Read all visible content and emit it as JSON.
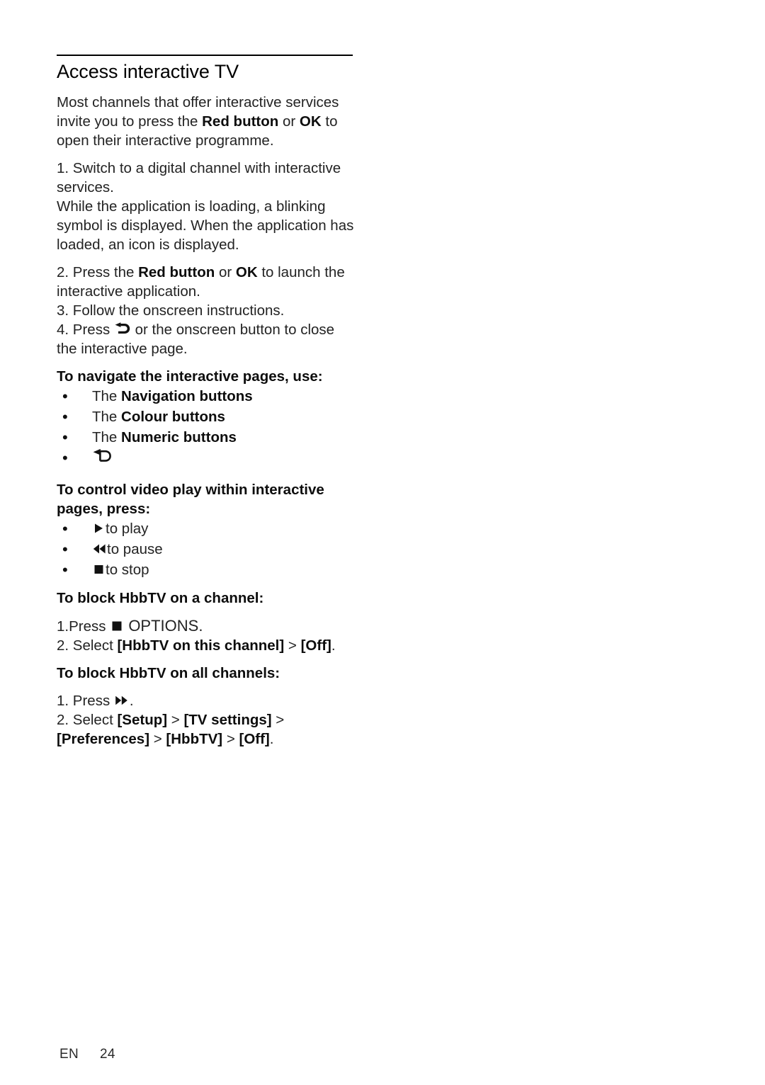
{
  "document": {
    "title": "Access interactive TV",
    "footer": {
      "language": "EN",
      "page_number": "24"
    }
  },
  "intro": {
    "part1": "Most channels that offer interactive services invite you to press the ",
    "bold1": "Red button",
    "part2": " or ",
    "bold2": "OK",
    "part3": " to open their interactive programme."
  },
  "steps": {
    "step1": "1. Switch to a digital channel with interactive services.",
    "note": "While the application is loading, a blinking symbol is displayed. When the application has loaded, an icon is displayed.",
    "step2_part1": "2. Press the ",
    "step2_bold1": "Red button",
    "step2_part2": " or ",
    "step2_bold2": "OK",
    "step2_part3": " to launch the interactive application.",
    "step3": "3. Follow the onscreen instructions.",
    "step4_part1": "4. Press ",
    "step4_icon": "back-arrow-icon",
    "step4_part2": " or the onscreen button to close the interactive page."
  },
  "navigate_section": {
    "heading": "To navigate the interactive pages, use:",
    "items": [
      {
        "prefix": "The ",
        "bold": "Navigation buttons",
        "icon": null
      },
      {
        "prefix": "The ",
        "bold": "Colour buttons",
        "icon": null
      },
      {
        "prefix": "The ",
        "bold": "Numeric buttons",
        "icon": null
      },
      {
        "prefix": "",
        "bold": "",
        "icon": "back-arrow-icon"
      }
    ]
  },
  "video_section": {
    "heading": "To control video play within interactive pages, press:",
    "items": [
      {
        "icon": "play-icon",
        "label": "to play"
      },
      {
        "icon": "rewind-icon",
        "label": "to pause"
      },
      {
        "icon": "stop-icon",
        "label": "to stop"
      }
    ]
  },
  "block_channel": {
    "heading": "To block HbbTV on a channel:",
    "step1_part1": "1.Press ",
    "step1_icon": "stop-square-icon",
    "step1_part2": " OPTIONS.",
    "step2_part1": "2. Select ",
    "step2_bold1": "[HbbTV on this channel]",
    "step2_part2": " > ",
    "step2_bold2": "[Off]",
    "step2_part3": "."
  },
  "block_all": {
    "heading": "To block HbbTV on all channels:",
    "step1_part1": "1. Press ",
    "step1_icon": "fast-forward-icon",
    "step1_part2": ".",
    "step2_part1": "2. Select ",
    "step2_bold1": "[Setup]",
    "step2_part2": " > ",
    "step2_bold2": "[TV settings]",
    "step2_part3": " > ",
    "step2_bold3": "[Preferences]",
    "step2_part4": " > ",
    "step2_bold4": "[HbbTV]",
    "step2_part5": " > ",
    "step2_bold5": "[Off]",
    "step2_part6": "."
  },
  "colors": {
    "text": "#232323",
    "bold_text": "#0d0d0d",
    "rule": "#000000",
    "background": "#ffffff"
  }
}
